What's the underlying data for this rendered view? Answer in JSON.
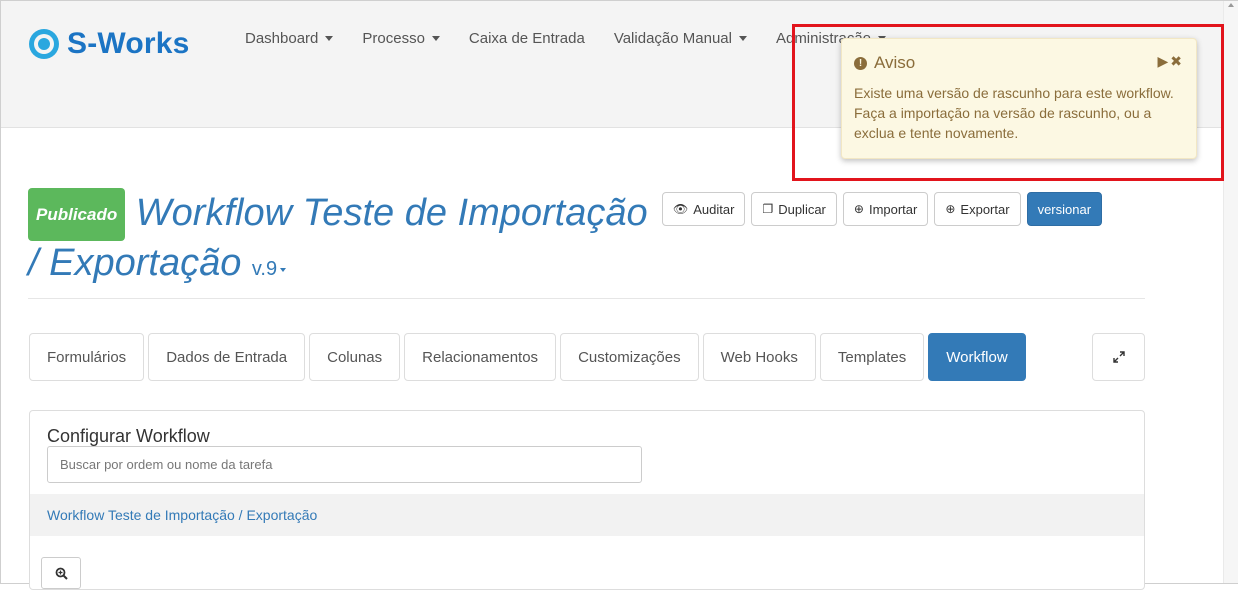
{
  "brand": {
    "name": "S-Works",
    "logo_icon": "s-works-logo-icon",
    "color": "#1b74c4"
  },
  "nav": {
    "items": [
      {
        "label": "Dashboard",
        "has_caret": true
      },
      {
        "label": "Processo",
        "has_caret": true
      },
      {
        "label": "Caixa de Entrada",
        "has_caret": false
      },
      {
        "label": "Validação Manual",
        "has_caret": true
      },
      {
        "label": "Administração",
        "has_caret": true
      }
    ]
  },
  "aviso": {
    "title": "Aviso",
    "message": "Existe uma versão de rascunho para este workflow. Faça a importação na versão de rascunho, ou a exclua e tente novamente.",
    "controls": "▶✖",
    "bg_color": "#fcf8e3",
    "text_color": "#8a6d3b"
  },
  "workflow": {
    "status": "Publicado",
    "status_color": "#5cb85c",
    "title": "Workflow Teste de Importação / Exportação",
    "version": "v.9"
  },
  "actions": {
    "auditar": "Auditar",
    "duplicar": "Duplicar",
    "importar": "Importar",
    "exportar": "Exportar",
    "versionar": "versionar"
  },
  "tabs": [
    {
      "label": "Formulários",
      "active": false
    },
    {
      "label": "Dados de Entrada",
      "active": false
    },
    {
      "label": "Colunas",
      "active": false
    },
    {
      "label": "Relacionamentos",
      "active": false
    },
    {
      "label": "Customizações",
      "active": false
    },
    {
      "label": "Web Hooks",
      "active": false
    },
    {
      "label": "Templates",
      "active": false
    },
    {
      "label": "Workflow",
      "active": true
    }
  ],
  "panel": {
    "title": "Configurar Workflow",
    "search_placeholder": "Buscar por ordem ou nome da tarefa",
    "breadcrumb": "Workflow Teste de Importação / Exportação"
  },
  "accent_color": "#337ab7"
}
